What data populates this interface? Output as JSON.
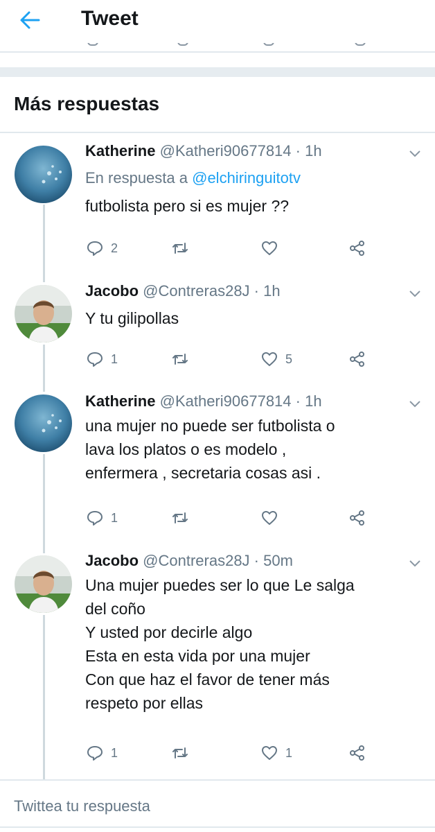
{
  "header": {
    "title": "Tweet"
  },
  "section_title": "Más respuestas",
  "tweets": [
    {
      "name": "Katherine",
      "meta": "@Katheri90677814 · 1h",
      "reply_prefix": "En respuesta a ",
      "reply_mention": "@elchiringuitotv",
      "lines": [
        "futbolista pero si es mujer ??"
      ],
      "replies": "2",
      "retweets": "",
      "likes": ""
    },
    {
      "name": "Jacobo",
      "meta": "@Contreras28J · 1h",
      "lines": [
        "Y tu gilipollas"
      ],
      "replies": "1",
      "retweets": "",
      "likes": "5"
    },
    {
      "name": "Katherine",
      "meta": "@Katheri90677814 · 1h",
      "lines": [
        "una mujer no puede ser futbolista o",
        "lava los platos o es modelo ,",
        "enfermera , secretaria cosas asi ."
      ],
      "replies": "1",
      "retweets": "",
      "likes": ""
    },
    {
      "name": "Jacobo",
      "meta": "@Contreras28J · 50m",
      "lines": [
        "Una mujer puedes ser lo que Le salga",
        "del coño",
        "Y usted por decirle algo",
        "Esta en esta vida por una mujer",
        "Con que haz el favor de tener más",
        "respeto por ellas"
      ],
      "replies": "1",
      "retweets": "",
      "likes": "1"
    }
  ],
  "compose": {
    "placeholder": "Twittea tu respuesta"
  },
  "colors": {
    "accent": "#1da1f2",
    "muted": "#657786",
    "text": "#14171a",
    "divider": "#e1e8ed"
  }
}
